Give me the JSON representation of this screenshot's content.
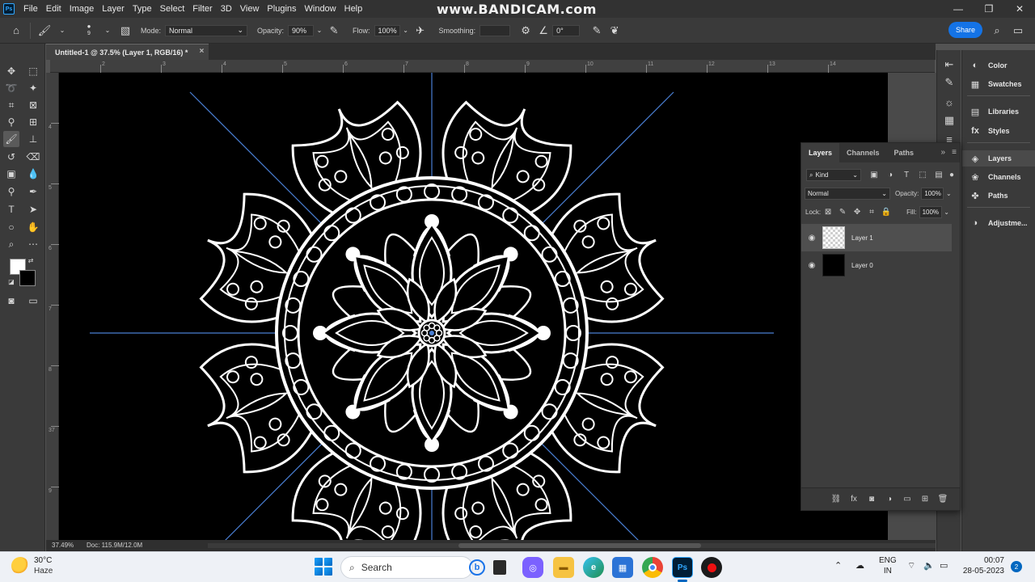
{
  "overlay": {
    "watermark": "www.BANDICAM.com"
  },
  "app": {
    "logo": "Ps"
  },
  "menu": [
    "File",
    "Edit",
    "Image",
    "Layer",
    "Type",
    "Select",
    "Filter",
    "3D",
    "View",
    "Plugins",
    "Window",
    "Help"
  ],
  "options": {
    "brush_size": "9",
    "mode_label": "Mode:",
    "mode_value": "Normal",
    "opacity_label": "Opacity:",
    "opacity_value": "90%",
    "flow_label": "Flow:",
    "flow_value": "100%",
    "smoothing_label": "Smoothing:",
    "angle_value": "0°",
    "share_label": "Share"
  },
  "document": {
    "tab_title": "Untitled-1 @ 37.5% (Layer 1, RGB/16) *",
    "zoom": "37.49%",
    "doc_info": "Doc: 115.9M/12.0M"
  },
  "rulers": {
    "top": [
      "2",
      "3",
      "4",
      "5",
      "6",
      "7",
      "8",
      "9",
      "10",
      "11",
      "12",
      "13",
      "14"
    ],
    "left": [
      "4",
      "5",
      "6",
      "7",
      "8",
      "37",
      "9"
    ]
  },
  "dock": {
    "items": [
      {
        "label": "Color",
        "icon": "color-icon"
      },
      {
        "label": "Swatches",
        "icon": "swatches-icon"
      },
      {
        "label": "Libraries",
        "icon": "libraries-icon"
      },
      {
        "label": "Styles",
        "icon": "styles-icon"
      },
      {
        "label": "Layers",
        "icon": "layers-icon"
      },
      {
        "label": "Channels",
        "icon": "channels-icon"
      },
      {
        "label": "Paths",
        "icon": "paths-icon"
      },
      {
        "label": "Adjustme...",
        "icon": "adjustments-icon"
      }
    ]
  },
  "layers_panel": {
    "tabs": [
      "Layers",
      "Channels",
      "Paths"
    ],
    "filter_kind": "Kind",
    "blend_mode": "Normal",
    "opacity_label": "Opacity:",
    "opacity_value": "100%",
    "lock_label": "Lock:",
    "fill_label": "Fill:",
    "fill_value": "100%",
    "layers": [
      {
        "name": "Layer 1",
        "selected": true,
        "thumb": "transparent"
      },
      {
        "name": "Layer 0",
        "selected": false,
        "thumb": "black"
      }
    ]
  },
  "taskbar": {
    "weather_temp": "30°C",
    "weather_cond": "Haze",
    "search_label": "Search",
    "lang_line1": "ENG",
    "lang_line2": "IN",
    "time": "00:07",
    "date": "28-05-2023",
    "notifications": "2"
  },
  "colors": {
    "accent": "#1473e6",
    "canvas_bg": "#000000",
    "guide": "#4a7fd4",
    "mandala": "#ffffff"
  }
}
